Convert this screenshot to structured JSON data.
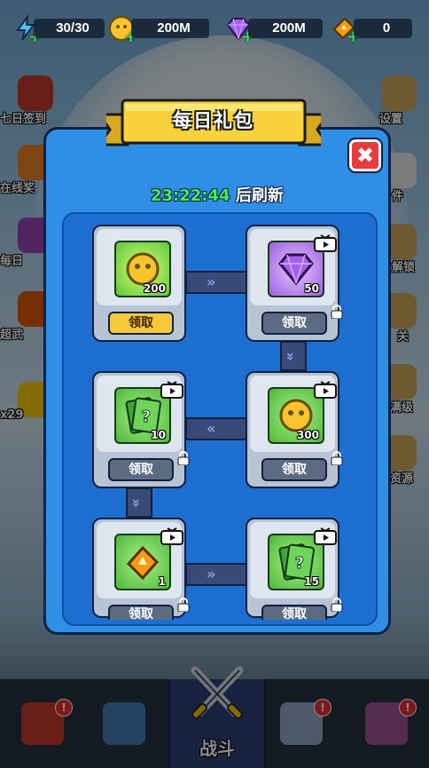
{
  "top_bar": {
    "energy": {
      "value": "30/30",
      "icon": "lightning-icon"
    },
    "coins": {
      "value": "200M",
      "icon": "coin-icon"
    },
    "gems": {
      "value": "200M",
      "icon": "gem-icon"
    },
    "tickets": {
      "value": "0",
      "icon": "ticket-icon"
    }
  },
  "side_left": [
    {
      "label": "七日签到",
      "icon": "calendar-7-icon"
    },
    {
      "label": "在线奖",
      "icon": "gift-icon"
    },
    {
      "label": "每日",
      "icon": "daily-icon"
    },
    {
      "label": "超武",
      "icon": "super-weapon-icon"
    },
    {
      "label": "x29",
      "icon": "item-icon"
    }
  ],
  "side_right": [
    {
      "label": "设置",
      "icon": "gear-icon"
    },
    {
      "label": "件",
      "icon": "mail-icon"
    },
    {
      "label": "解锁",
      "icon": "unlock-icon"
    },
    {
      "label": "关",
      "icon": "level-icon"
    },
    {
      "label": "满级",
      "icon": "max-level-icon"
    },
    {
      "label": "资源",
      "icon": "resource-icon"
    }
  ],
  "dialog": {
    "title": "每日礼包",
    "timer": "23:22:44",
    "timer_suffix": "后刷新",
    "close_symbol": "✖",
    "rewards": [
      {
        "name": "coin",
        "qty": "200",
        "button": "领取",
        "state": "active",
        "video": false
      },
      {
        "name": "gem",
        "qty": "50",
        "button": "领取",
        "state": "locked",
        "video": true
      },
      {
        "name": "card",
        "qty": "10",
        "button": "领取",
        "state": "locked",
        "video": true
      },
      {
        "name": "coin",
        "qty": "300",
        "button": "领取",
        "state": "locked",
        "video": true
      },
      {
        "name": "ticket",
        "qty": "1",
        "button": "领取",
        "state": "locked",
        "video": true
      },
      {
        "name": "card",
        "qty": "15",
        "button": "领取",
        "state": "locked",
        "video": true
      }
    ],
    "arrow_right": "»",
    "arrow_left": "«",
    "arrow_down": "»"
  },
  "bottom_nav": {
    "shop_badge": "!",
    "cards_badge": "",
    "battle_label": "战斗",
    "castle_badge": "!",
    "skull_badge": "!"
  },
  "colors": {
    "panel_blue": "#2f8fe6",
    "banner_yellow": "#f7d23a",
    "timer_green": "#3ef05c",
    "button_yellow": "#f7c93a",
    "close_red": "#e83a3f"
  }
}
